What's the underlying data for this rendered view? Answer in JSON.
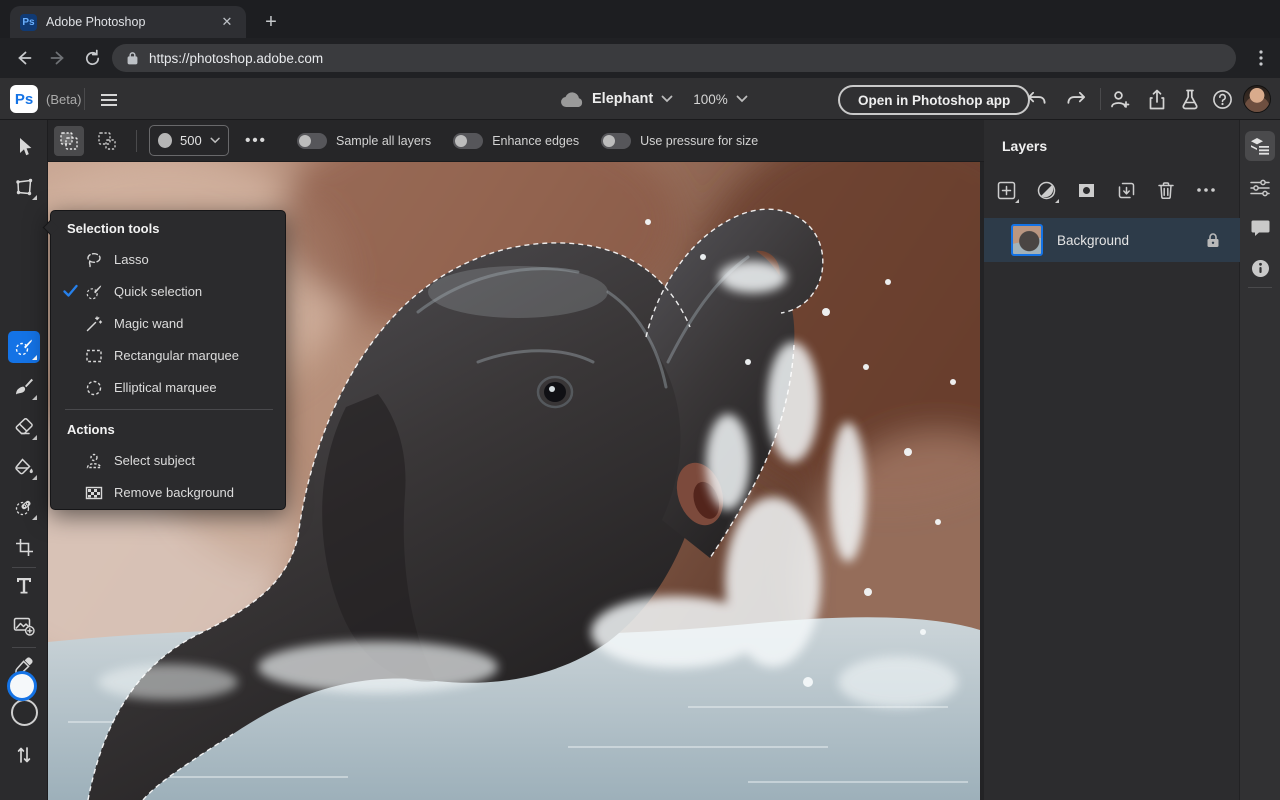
{
  "colors": {
    "accent": "#1473e6",
    "checkmark": "#2680eb",
    "selected_layer_row": "#2d3b49",
    "ps_header_bg": "#303032",
    "browser_frame_bg": "#202124"
  },
  "browser": {
    "tab_title": "Adobe Photoshop",
    "url": "https://photoshop.adobe.com"
  },
  "app_header": {
    "logo_text": "Ps",
    "beta_label": "(Beta)",
    "document_name": "Elephant",
    "zoom_level": "100%",
    "open_app_button": "Open in Photoshop app"
  },
  "options_bar": {
    "brush_size": "500",
    "toggles": [
      {
        "label": "Sample all layers",
        "on": false
      },
      {
        "label": "Enhance edges",
        "on": false
      },
      {
        "label": "Use pressure for size",
        "on": false
      }
    ]
  },
  "tool_menu": {
    "title": "Selection tools",
    "items": [
      {
        "label": "Lasso",
        "checked": false
      },
      {
        "label": "Quick selection",
        "checked": true
      },
      {
        "label": "Magic wand",
        "checked": false
      },
      {
        "label": "Rectangular marquee",
        "checked": false
      },
      {
        "label": "Elliptical marquee",
        "checked": false
      }
    ],
    "actions_title": "Actions",
    "actions": [
      {
        "label": "Select subject"
      },
      {
        "label": "Remove background"
      }
    ]
  },
  "layers_panel": {
    "title": "Layers",
    "layers": [
      {
        "name": "Background",
        "locked": true,
        "selected": true
      }
    ]
  }
}
